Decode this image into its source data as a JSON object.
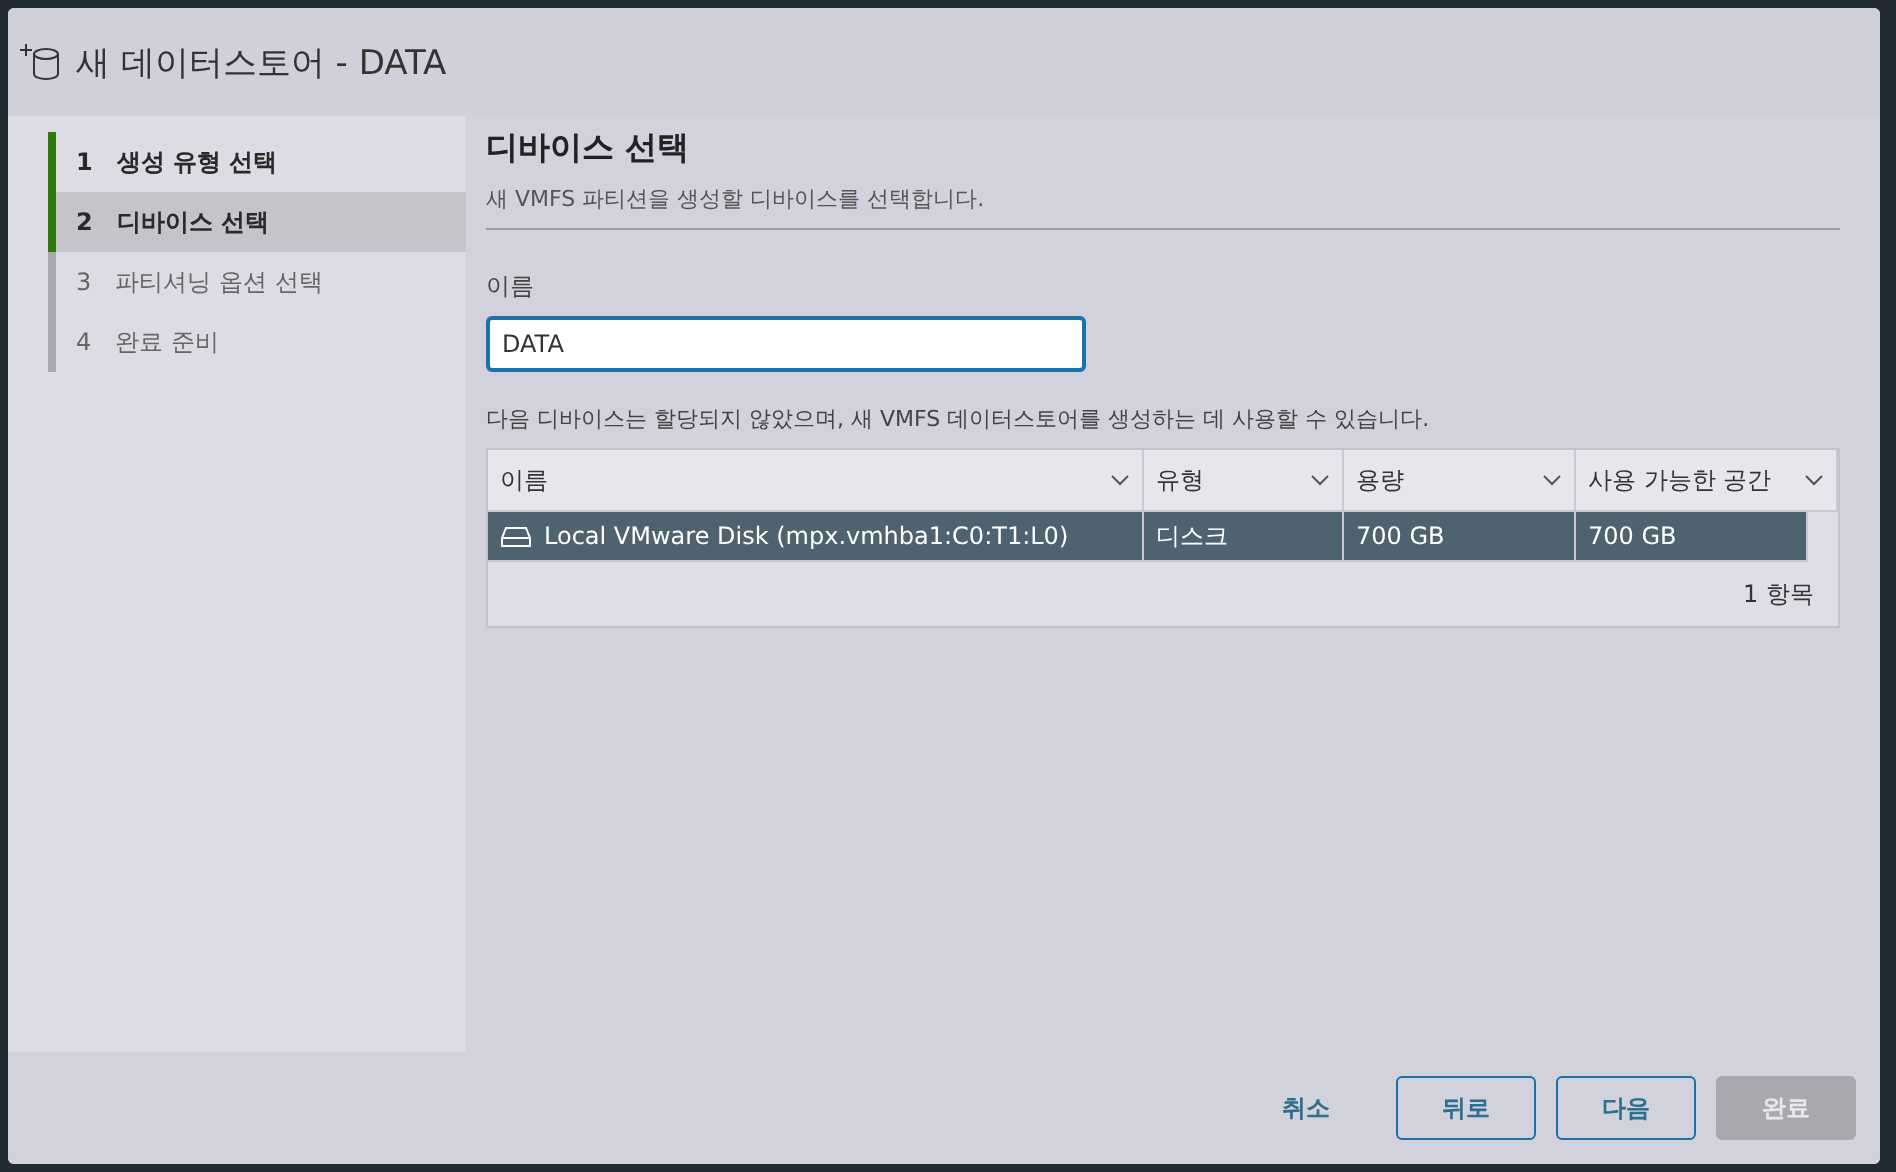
{
  "window": {
    "title": "새 데이터스토어 - DATA"
  },
  "steps": [
    {
      "number": "1",
      "label": "생성 유형 선택",
      "completed": true,
      "selected": false
    },
    {
      "number": "2",
      "label": "디바이스 선택",
      "completed": true,
      "selected": true
    },
    {
      "number": "3",
      "label": "파티셔닝 옵션 선택",
      "completed": false,
      "selected": false
    },
    {
      "number": "4",
      "label": "완료 준비",
      "completed": false,
      "selected": false
    }
  ],
  "page": {
    "title": "디바이스 선택",
    "subtitle": "새 VMFS 파티션을 생성할 디바이스를 선택합니다."
  },
  "name_field": {
    "label": "이름",
    "value": "DATA"
  },
  "table": {
    "caption": "다음 디바이스는 할당되지 않았으며, 새 VMFS 데이터스토어를 생성하는 데 사용할 수 있습니다.",
    "columns": [
      "이름",
      "유형",
      "용량",
      "사용 가능한 공간"
    ],
    "rows": [
      {
        "cells": [
          "Local VMware Disk (mpx.vmhba1:C0:T1:L0)",
          "디스크",
          "700 GB",
          "700 GB"
        ],
        "selected": true
      }
    ],
    "footer": "1 항목"
  },
  "buttons": [
    {
      "label": "취소",
      "kind": "link",
      "disabled": false
    },
    {
      "label": "뒤로",
      "kind": "outline",
      "disabled": false
    },
    {
      "label": "다음",
      "kind": "outline",
      "disabled": false
    },
    {
      "label": "완료",
      "kind": "solid",
      "disabled": true
    }
  ]
}
